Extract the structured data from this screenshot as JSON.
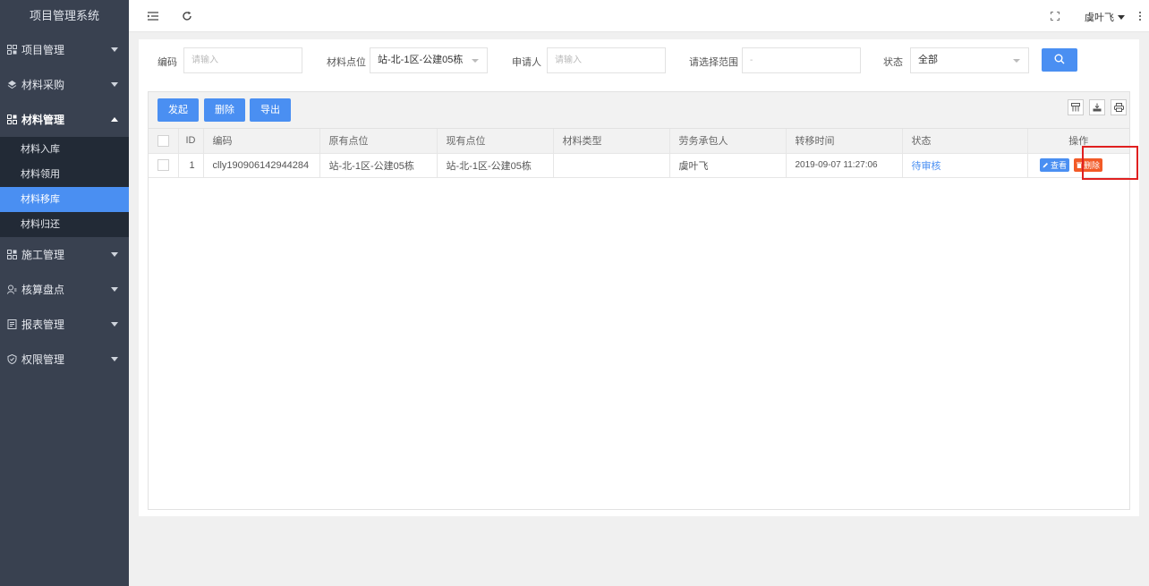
{
  "app": {
    "title": "项目管理系统"
  },
  "sidebar": {
    "items": [
      {
        "label": "项目管理",
        "icon": "project-icon",
        "expanded": false
      },
      {
        "label": "材料采购",
        "icon": "purchase-icon",
        "expanded": false
      },
      {
        "label": "材料管理",
        "icon": "material-icon",
        "expanded": true,
        "children": [
          {
            "label": "材料入库",
            "active": false
          },
          {
            "label": "材料领用",
            "active": false
          },
          {
            "label": "材料移库",
            "active": true
          },
          {
            "label": "材料归还",
            "active": false
          }
        ]
      },
      {
        "label": "施工管理",
        "icon": "construction-icon",
        "expanded": false
      },
      {
        "label": "核算盘点",
        "icon": "accounting-icon",
        "expanded": false
      },
      {
        "label": "报表管理",
        "icon": "report-icon",
        "expanded": false
      },
      {
        "label": "权限管理",
        "icon": "permission-icon",
        "expanded": false
      }
    ]
  },
  "topbar": {
    "user_name": "虞叶飞"
  },
  "filters": {
    "code_label": "编码",
    "code_placeholder": "请输入",
    "location_label": "材料点位",
    "location_value": "站-北-1区-公建05栋",
    "applicant_label": "申请人",
    "applicant_placeholder": "请输入",
    "range_label": "请选择范围",
    "range_placeholder": "-",
    "status_label": "状态",
    "status_value": "全部"
  },
  "toolbar": {
    "initiate_label": "发起",
    "delete_label": "删除",
    "export_label": "导出"
  },
  "table": {
    "headers": [
      "ID",
      "编码",
      "原有点位",
      "现有点位",
      "材料类型",
      "劳务承包人",
      "转移时间",
      "状态",
      "操作"
    ],
    "rows": [
      {
        "id": "1",
        "code": "clly190906142944284",
        "original_location": "站-北-1区-公建05栋",
        "current_location": "站-北-1区-公建05栋",
        "material_type": "",
        "contractor": "虞叶飞",
        "transfer_time": "2019-09-07 11:27:06",
        "status": "待审核",
        "view_label": "查看",
        "delete_label": "删除"
      }
    ]
  },
  "colors": {
    "primary": "#4a8ff2",
    "danger": "#f25a27",
    "sidebar": "#394150",
    "highlight": "#e02020"
  }
}
